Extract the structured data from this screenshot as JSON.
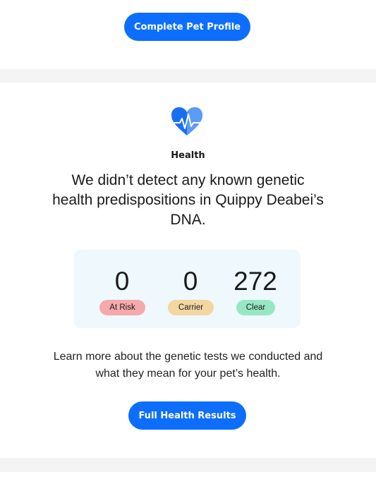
{
  "top": {
    "complete_profile_label": "Complete Pet Profile"
  },
  "health": {
    "icon": "heart-pulse-icon",
    "section_label": "Health",
    "headline": "We didn’t detect any known genetic health predispositions in Quippy Deabei’s DNA.",
    "stats": [
      {
        "value": "0",
        "label": "At Risk",
        "color": "#f6a9ab"
      },
      {
        "value": "0",
        "label": "Carrier",
        "color": "#f3d6a1"
      },
      {
        "value": "272",
        "label": "Clear",
        "color": "#96e7c4"
      }
    ],
    "learn_more": "Learn more about the genetic tests we conducted and what they mean for your pet’s health.",
    "full_results_label": "Full Health Results"
  },
  "colors": {
    "primary": "#0d6efd",
    "card_bg": "#eef8fd",
    "band_bg": "#f4f4f4"
  }
}
